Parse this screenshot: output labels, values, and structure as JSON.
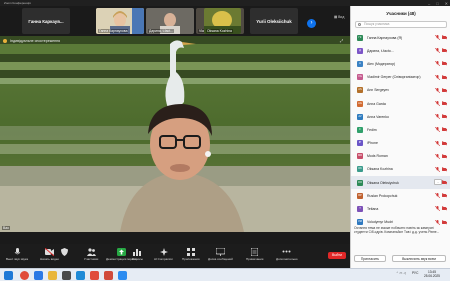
{
  "window": {
    "title": "Zoom Конференція"
  },
  "gallery": {
    "banner_name": "Ганна Каркаув...",
    "tiles": [
      {
        "name": "Ганна Карнаухова"
      },
      {
        "name": "Дарина, t-fact..."
      },
      {
        "name": "Vladimir Gerper"
      },
      {
        "name": "Oksana Kozhina"
      },
      {
        "name": "Yurii Oleksiichuk"
      }
    ],
    "view_label": "Вид"
  },
  "video": {
    "label": "Індивідуальне спостереження",
    "speaker": "Bao"
  },
  "panel": {
    "title": "Учасники (48)",
    "search_placeholder": "Пошук учасника",
    "participants": [
      {
        "initials": "ГК",
        "name": "Ганна Карнаухова (Я)",
        "color": "#2d8a57"
      },
      {
        "initials": "Д",
        "name": "Дарина, t-facto...",
        "color": "#7c55c7"
      },
      {
        "initials": "A",
        "name": "Alex (Модератор)",
        "color": "#3b82c4"
      },
      {
        "initials": "VG",
        "name": "Vladimir Gerper (Співорганізатор)",
        "color": "#c55a8e"
      },
      {
        "initials": "AS",
        "name": "Ann Sergeyev",
        "color": "#b3702a"
      },
      {
        "initials": "AG",
        "name": "Anna Garda",
        "color": "#d16b32"
      },
      {
        "initials": "AV",
        "name": "Anna Varenko",
        "color": "#2e7bbf"
      },
      {
        "initials": "F",
        "name": "Fedim",
        "color": "#30a06b"
      },
      {
        "initials": "IP",
        "name": "iPhone",
        "color": "#6a55c8"
      },
      {
        "initials": "MR",
        "name": "Mods Roman",
        "color": "#c84d6a"
      },
      {
        "initials": "OK",
        "name": "Oksana Kozhina",
        "color": "#3b9b8c"
      },
      {
        "initials": "OO",
        "name": "Oksana Oleksiychuk",
        "color": "#2d8a57"
      },
      {
        "initials": "RP",
        "name": "Ruslan Prokopchuk",
        "color": "#c0612f"
      },
      {
        "initials": "T",
        "name": "Tetiana",
        "color": "#7d52b8"
      },
      {
        "initials": "VM",
        "name": "Volodymyr Mudri",
        "color": "#2f79c0"
      }
    ],
    "selected_index": 11,
    "more_label": "...",
    "message": "Остання тема не зможе побачити навіть як кампусні студенти Сіб-сдрів. Компаньйон Тав і д.д. учень Рівне...",
    "invite_label": "Пригласить",
    "mute_all_label": "Выключить звук всем"
  },
  "toolbar": {
    "audio_label": "Выкл звук звука",
    "video_label": "Начать видео",
    "security_label": "",
    "participants_label": "Участники",
    "share_label": "Демонстрация экрана",
    "polls_label": "Опросы",
    "ai_label": "AI Companion",
    "apps_label": "Приложения",
    "reactions_label": "Доска сообщений",
    "notes_label": "Примечания",
    "more_label": "Дополнительно",
    "leave_label": "Выйти"
  },
  "taskbar": {
    "lang": "РУС",
    "time": "13:45",
    "date": "25.06.2025"
  },
  "colors": {
    "accent": "#0e72ed",
    "leave": "#e02828"
  }
}
